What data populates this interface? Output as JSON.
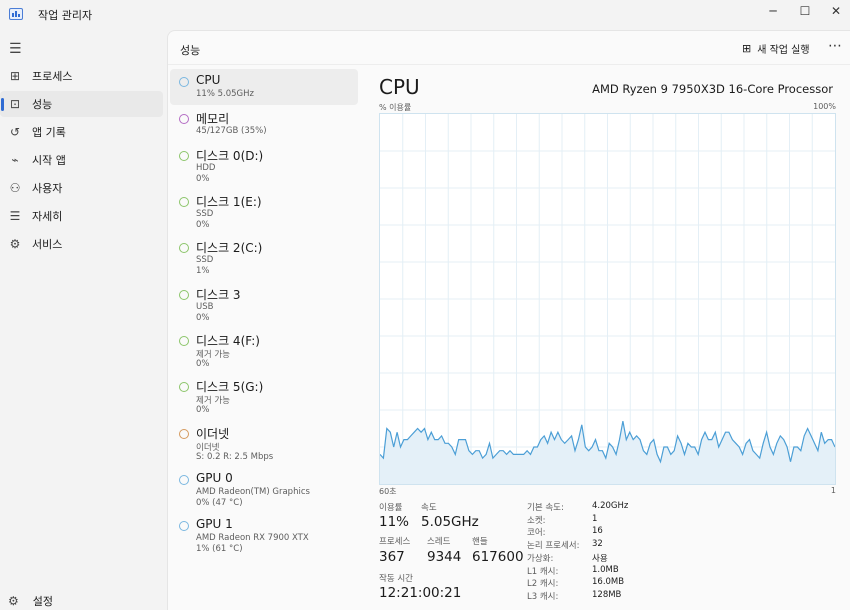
{
  "window": {
    "title": "작업 관리자",
    "controls": {
      "minimize": "─",
      "maximize": "☐",
      "close": "✕"
    }
  },
  "nav": {
    "items": [
      {
        "id": "processes",
        "label": "프로세스",
        "icon": "processes-icon",
        "glyph": "⊞"
      },
      {
        "id": "performance",
        "label": "성능",
        "icon": "performance-icon",
        "glyph": "⊡",
        "active": true
      },
      {
        "id": "app-history",
        "label": "앱 기록",
        "icon": "history-icon",
        "glyph": "↺"
      },
      {
        "id": "startup",
        "label": "시작 앱",
        "icon": "startup-icon",
        "glyph": "⌁"
      },
      {
        "id": "users",
        "label": "사용자",
        "icon": "users-icon",
        "glyph": "⚇"
      },
      {
        "id": "details",
        "label": "자세히",
        "icon": "details-icon",
        "glyph": "☰"
      },
      {
        "id": "services",
        "label": "서비스",
        "icon": "services-icon",
        "glyph": "⚙"
      }
    ],
    "settings_label": "설정"
  },
  "header": {
    "title": "성능",
    "run_task_label": "새 작업 실행",
    "more": "⋯"
  },
  "resources": [
    {
      "name": "CPU",
      "lines": [
        "11% 5.05GHz"
      ],
      "color": "#7ab7e0",
      "active": true
    },
    {
      "name": "메모리",
      "lines": [
        "45/127GB (35%)"
      ],
      "color": "#b46cc4"
    },
    {
      "name": "디스크 0(D:)",
      "lines": [
        "HDD",
        "0%"
      ],
      "color": "#8cc56a"
    },
    {
      "name": "디스크 1(E:)",
      "lines": [
        "SSD",
        "0%"
      ],
      "color": "#8cc56a"
    },
    {
      "name": "디스크 2(C:)",
      "lines": [
        "SSD",
        "1%"
      ],
      "color": "#8cc56a"
    },
    {
      "name": "디스크 3",
      "lines": [
        "USB",
        "0%"
      ],
      "color": "#8cc56a"
    },
    {
      "name": "디스크 4(F:)",
      "lines": [
        "제거 가능",
        "0%"
      ],
      "color": "#8cc56a"
    },
    {
      "name": "디스크 5(G:)",
      "lines": [
        "제거 가능",
        "0%"
      ],
      "color": "#8cc56a"
    },
    {
      "name": "이더넷",
      "lines": [
        "이더넷",
        "S: 0.2  R: 2.5 Mbps"
      ],
      "color": "#d59a5e"
    },
    {
      "name": "GPU 0",
      "lines": [
        "AMD Radeon(TM) Graphics",
        "0% (47 °C)"
      ],
      "color": "#7ab7e0"
    },
    {
      "name": "GPU 1",
      "lines": [
        "AMD Radeon RX 7900 XTX",
        "1% (61 °C)"
      ],
      "color": "#7ab7e0"
    }
  ],
  "cpu": {
    "title": "CPU",
    "model": "AMD Ryzen 9 7950X3D 16-Core Processor",
    "graph": {
      "y_label": "% 이용률",
      "y_max": "100%",
      "x_left": "60초",
      "x_right": "1",
      "line_color": "#4c9fd6",
      "fill_color": "#e4f0f8",
      "values": [
        8,
        7,
        15,
        14,
        10,
        14,
        10,
        12,
        12,
        13,
        14,
        15,
        14,
        15,
        12,
        14,
        12,
        12,
        13,
        11,
        11,
        10,
        8,
        12,
        12,
        12,
        9,
        8,
        9,
        9,
        7,
        8,
        11,
        7,
        8,
        9,
        9,
        8,
        9,
        8,
        8,
        8,
        8,
        9,
        8,
        10,
        10,
        12,
        13,
        11,
        14,
        12,
        14,
        12,
        11,
        12,
        13,
        9,
        12,
        16,
        10,
        9,
        10,
        12,
        9,
        9,
        7,
        11,
        10,
        8,
        12,
        17,
        12,
        14,
        12,
        13,
        12,
        9,
        8,
        11,
        12,
        8,
        6,
        10,
        10,
        8,
        9,
        13,
        11,
        8,
        11,
        10,
        10,
        8,
        12,
        14,
        12,
        12,
        14,
        10,
        12,
        14,
        14,
        12,
        11,
        10,
        8,
        11,
        12,
        9,
        8,
        7,
        11,
        14,
        10,
        8,
        11,
        13,
        12,
        10,
        6,
        10,
        10,
        9,
        13,
        15,
        13,
        11,
        9,
        14,
        11,
        12,
        12,
        10
      ],
      "grid_cols": 20,
      "grid_rows": 10
    },
    "stats": {
      "utilization_label": "이용률",
      "utilization": "11%",
      "speed_label": "속도",
      "speed": "5.05GHz",
      "processes_label": "프로세스",
      "processes": "367",
      "threads_label": "스레드",
      "threads": "9344",
      "handles_label": "핸들",
      "handles": "617600",
      "uptime_label": "작동 시간",
      "uptime": "12:21:00:21"
    },
    "specs": [
      {
        "label": "기본 속도:",
        "value": "4.20GHz"
      },
      {
        "label": "소켓:",
        "value": "1"
      },
      {
        "label": "코어:",
        "value": "16"
      },
      {
        "label": "논리 프로세서:",
        "value": "32"
      },
      {
        "label": "가상화:",
        "value": "사용"
      },
      {
        "label": "L1 캐시:",
        "value": "1.0MB"
      },
      {
        "label": "L2 캐시:",
        "value": "16.0MB"
      },
      {
        "label": "L3 캐시:",
        "value": "128MB"
      }
    ]
  }
}
